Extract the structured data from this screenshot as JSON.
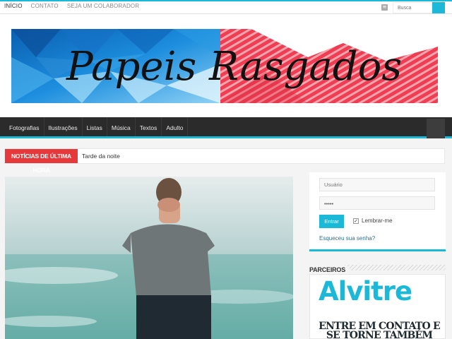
{
  "top_nav": [
    "INÍCIO",
    "CONTATO",
    "SEJA UM COLABORADOR"
  ],
  "search": {
    "placeholder": "Busca"
  },
  "site": {
    "title": "Papeis Rasgados"
  },
  "main_nav": [
    "Fotografias",
    "Ilustrações",
    "Listas",
    "Música",
    "Textos",
    "Adulto"
  ],
  "breaking": {
    "label": "NOTÍCIAS DE ÚLTIMA HORA",
    "text": "Tarde da noite"
  },
  "login": {
    "username_placeholder": "Usuário",
    "password_value": "•••••",
    "submit_label": "Entrar",
    "remember_label": "Lembrar-me",
    "forgot_label": "Esqueceu sua senha?"
  },
  "partners": {
    "title": "PARCEIROS",
    "logo_text": "Alvitre",
    "tagline": "ENTRE EM CONTATO E SE TORNE TAMBÉM"
  },
  "colors": {
    "accent": "#1bb8d8",
    "breaking": "#e6393b",
    "nav_bg": "#2b2b2b"
  }
}
